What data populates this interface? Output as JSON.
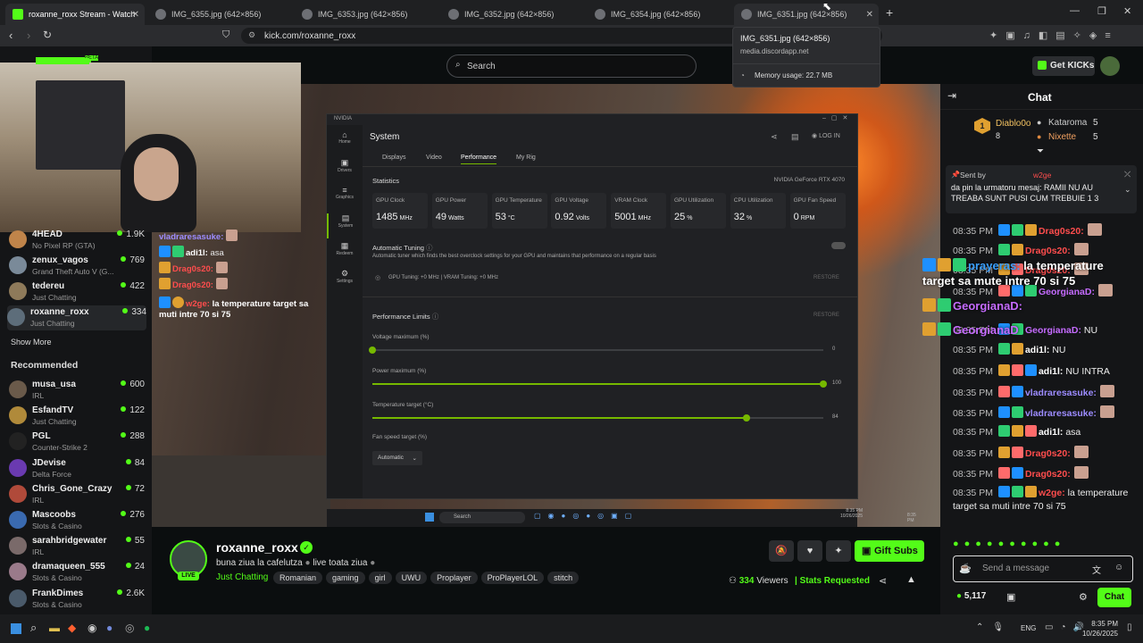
{
  "tabs": [
    {
      "title": "roxanne_roxx Stream - Watch",
      "active": true,
      "color": "#53fc18"
    },
    {
      "title": "IMG_6355.jpg (642×856)",
      "active": false,
      "color": "#6d6f74"
    },
    {
      "title": "IMG_6353.jpg (642×856)",
      "active": false,
      "color": "#6d6f74"
    },
    {
      "title": "IMG_6352.jpg (642×856)",
      "active": false,
      "color": "#6d6f74"
    },
    {
      "title": "IMG_6354.jpg (642×856)",
      "active": false,
      "color": "#6d6f74"
    },
    {
      "title": "IMG_6351.jpg (642×856)",
      "active": false,
      "color": "#6d6f74"
    }
  ],
  "url": "kick.com/roxanne_roxx",
  "tooltip": {
    "title": "IMG_6351.jpg (642×856)",
    "domain": "media.discordapp.net",
    "memory": "Memory usage: 22.7 MB"
  },
  "header": {
    "search_placeholder": "Search",
    "get_kicks": "Get KICKs",
    "logo_badge": "BETA"
  },
  "sidebar": {
    "following": [
      {
        "name": "4HEAD",
        "game": "No Pixel RP (GTA)",
        "viewers": "1.9K",
        "color": "#c0844a"
      },
      {
        "name": "zenux_vagos",
        "game": "Grand Theft Auto V (G...",
        "viewers": "769",
        "color": "#7a8a99"
      },
      {
        "name": "tedereu",
        "game": "Just Chatting",
        "viewers": "422",
        "color": "#8e7a5a"
      },
      {
        "name": "roxanne_roxx",
        "game": "Just Chatting",
        "viewers": "334",
        "color": "#5d6d7a"
      }
    ],
    "show_more": "Show More",
    "recommended_title": "Recommended",
    "recommended": [
      {
        "name": "musa_usa",
        "game": "IRL",
        "viewers": "600",
        "color": "#6a5a4a"
      },
      {
        "name": "EsfandTV",
        "game": "Just Chatting",
        "viewers": "122",
        "color": "#b08a3a"
      },
      {
        "name": "PGL",
        "game": "Counter-Strike 2",
        "viewers": "288",
        "color": "#222222"
      },
      {
        "name": "JDevise",
        "game": "Delta Force",
        "viewers": "84",
        "color": "#6a3ab0"
      },
      {
        "name": "Chris_Gone_Crazy",
        "game": "IRL",
        "viewers": "72",
        "color": "#b04a3a"
      },
      {
        "name": "Mascoobs",
        "game": "Slots & Casino",
        "viewers": "276",
        "color": "#3a6ab0"
      },
      {
        "name": "sarahbridgewater",
        "game": "IRL",
        "viewers": "55",
        "color": "#7a6a6a"
      },
      {
        "name": "dramaqueen_555",
        "game": "Slots & Casino",
        "viewers": "24",
        "color": "#9a7a8a"
      },
      {
        "name": "FrankDimes",
        "game": "Slots & Casino",
        "viewers": "2.6K",
        "color": "#4a5a6a"
      }
    ]
  },
  "overlay_chat": [
    {
      "user": "vladraresasuke:",
      "text": "",
      "color": "#9d8cff"
    },
    {
      "user": "adi1l:",
      "text": "asa",
      "color": "#ffffff"
    },
    {
      "user": "Drag0s20:",
      "text": "",
      "color": "#ff4d4d"
    },
    {
      "user": "Drag0s20:",
      "text": "",
      "color": "#ff4d4d"
    },
    {
      "user": "w2ge:",
      "text": "la temperature target sa muti intre 70 si 75",
      "color": "#ff4d4d"
    }
  ],
  "nvidia": {
    "brand": "NVIDIA",
    "section": "System",
    "login": "LOG IN",
    "nav": [
      "Home",
      "Drivers",
      "Graphics",
      "System",
      "Redeem",
      "Settings"
    ],
    "tabs": [
      "Displays",
      "Video",
      "Performance",
      "My Rig"
    ],
    "active_tab": "Performance",
    "statistics": "Statistics",
    "gpu_name": "NVIDIA GeForce RTX 4070",
    "stats": [
      {
        "label": "GPU Clock",
        "value": "1485",
        "unit": "MHz"
      },
      {
        "label": "GPU Power",
        "value": "49",
        "unit": "Watts"
      },
      {
        "label": "GPU Temperature",
        "value": "53",
        "unit": "°C"
      },
      {
        "label": "GPU Voltage",
        "value": "0.92",
        "unit": "Volts"
      },
      {
        "label": "VRAM Clock",
        "value": "5001",
        "unit": "MHz"
      },
      {
        "label": "GPU Utilization",
        "value": "25",
        "unit": "%"
      },
      {
        "label": "CPU Utilization",
        "value": "32",
        "unit": "%"
      },
      {
        "label": "GPU Fan Speed",
        "value": "0",
        "unit": "RPM"
      }
    ],
    "auto_tuning": "Automatic Tuning",
    "auto_desc": "Automatic tuner which finds the best overclock settings for your GPU and maintains that performance on a regular basis",
    "tuning_line": "GPU Tuning: +0 MHz  |  VRAM Tuning: +0 MHz",
    "restore": "RESTORE",
    "limits": "Performance Limits",
    "sliders": [
      {
        "label": "Voltage maximum (%)",
        "value": "0",
        "fraction": 0.0
      },
      {
        "label": "Power maximum (%)",
        "value": "100",
        "fraction": 1.0
      },
      {
        "label": "Temperature target (°C)",
        "value": "84",
        "fraction": 0.83
      }
    ],
    "fan_label": "Fan speed target (%)",
    "fan_value": "Automatic",
    "taskbar_search": "Search",
    "clock_time": "8:35 PM",
    "clock_date": "10/26/2025"
  },
  "stream": {
    "channel": "roxanne_roxx",
    "title": "buna ziua la cafelutza",
    "title2": "live toata ziua",
    "live": "LIVE",
    "category": "Just Chatting",
    "tags": [
      "Romanian",
      "gaming",
      "girl",
      "UWU",
      "Proplayer",
      "ProPlayerLOL",
      "stitch"
    ],
    "viewers": "334",
    "viewers_label": "Viewers",
    "stats_requested": "Stats Requested",
    "gift_subs": "Gift Subs"
  },
  "chat": {
    "title": "Chat",
    "leaderboard": [
      {
        "name": "Diablo0o",
        "count": "8",
        "rank": "1"
      },
      {
        "name": "Kataroma",
        "count": "5"
      },
      {
        "name": "Nixette",
        "count": "5"
      }
    ],
    "pinned_by": "Sent by",
    "pinned_user": "w2ge",
    "pinned_text": "da pin la urmatoru mesaj: RAMII NU AU TREABA SUNT PUSI CUM TREBUIE 1 3",
    "messages": [
      {
        "time": "08:35 PM",
        "user": "Drag0s20:",
        "text": "",
        "color": "#ff4d4d"
      },
      {
        "time": "08:35 PM",
        "user": "Drag0s20:",
        "text": "",
        "color": "#ff4d4d"
      },
      {
        "time": "08:35 PM",
        "user": "Drag0s20:",
        "text": "",
        "color": "#ff4d4d"
      },
      {
        "time": "08:35 PM",
        "user": "GeorgianaD:",
        "text": "",
        "color": "#c56bff"
      },
      {
        "time": "08:35 PM",
        "user": "GeorgianaD:",
        "text": "NU",
        "color": "#c56bff"
      },
      {
        "time": "08:35 PM",
        "user": "adi1l:",
        "text": "NU",
        "color": "#ffffff"
      },
      {
        "time": "08:35 PM",
        "user": "adi1l:",
        "text": "NU INTRA",
        "color": "#ffffff"
      },
      {
        "time": "08:35 PM",
        "user": "vladraresasuke:",
        "text": "",
        "color": "#9d8cff"
      },
      {
        "time": "08:35 PM",
        "user": "vladraresasuke:",
        "text": "",
        "color": "#9d8cff"
      },
      {
        "time": "08:35 PM",
        "user": "adi1l:",
        "text": "asa",
        "color": "#ffffff"
      },
      {
        "time": "08:35 PM",
        "user": "Drag0s20:",
        "text": "",
        "color": "#ff4d4d"
      },
      {
        "time": "08:35 PM",
        "user": "Drag0s20:",
        "text": "",
        "color": "#ff4d4d"
      },
      {
        "time": "08:35 PM",
        "user": "w2ge:",
        "text": "la temperature target sa muti intre 70 si 75",
        "color": "#ff4d4d"
      }
    ],
    "overlay1_user": "prayeras:",
    "overlay1_text": "la temperature target sa mute intre 70 si 75",
    "overlay2_user": "GeorgianaD:",
    "overlay3_user": "GeorgianaD",
    "input_placeholder": "Send a message",
    "kicks": "5,117",
    "send": "Chat"
  },
  "taskbar": {
    "lang": "ENG",
    "time": "8:35 PM",
    "date": "10/26/2025"
  },
  "colors": {
    "kick_green": "#53fc18",
    "nvidia_green": "#76b900"
  }
}
